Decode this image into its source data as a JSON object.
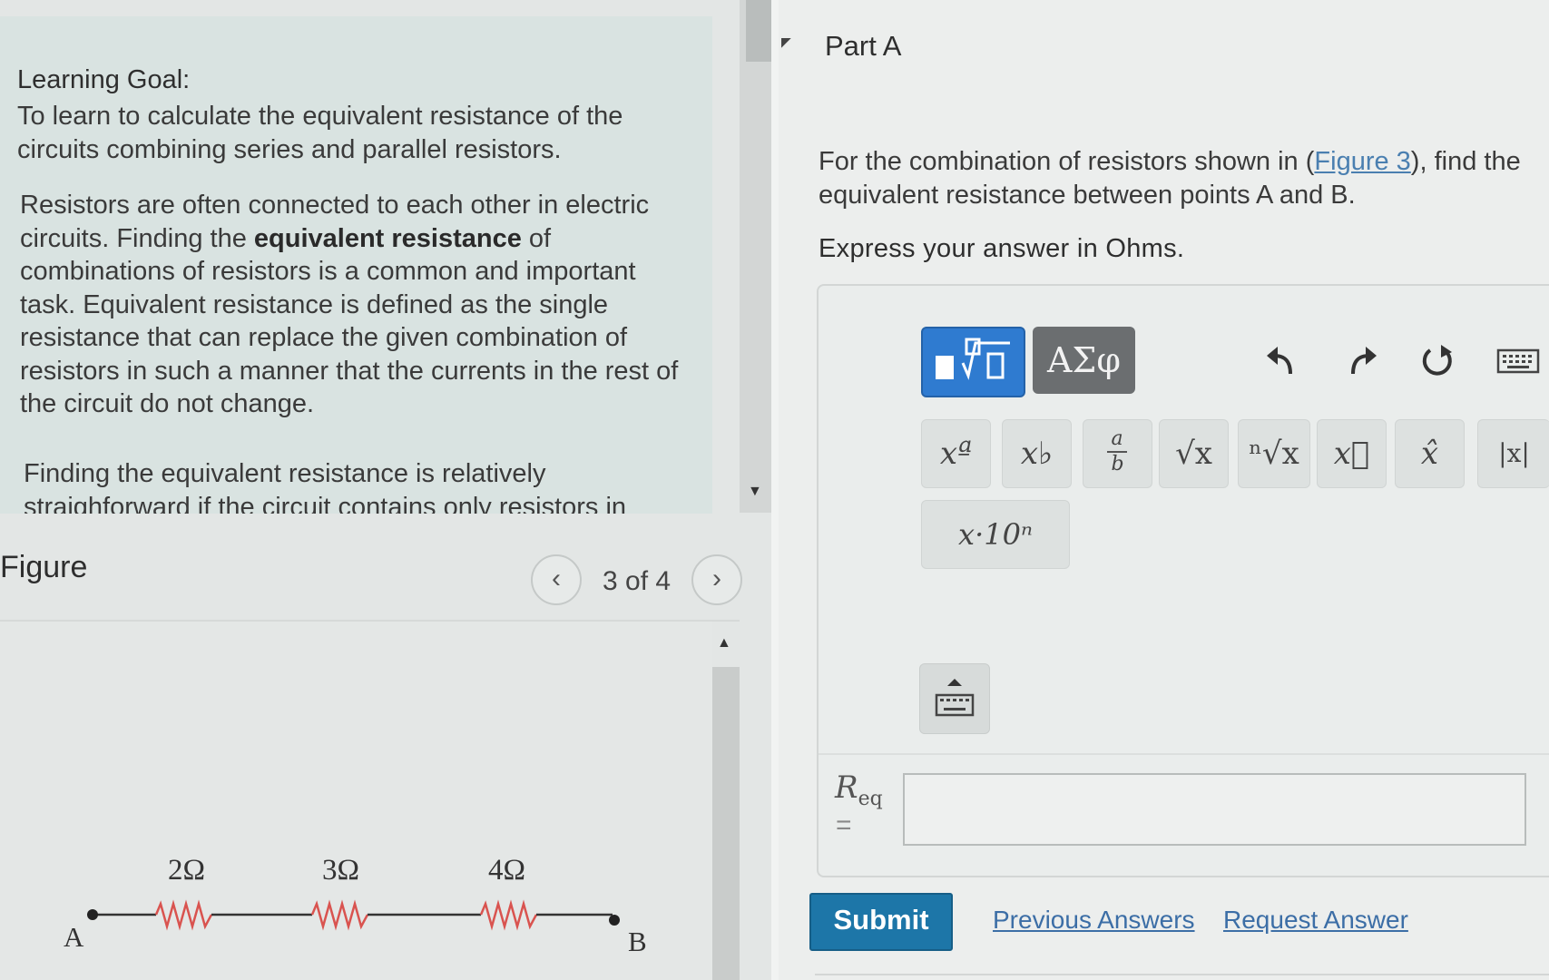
{
  "learning_goal": {
    "title": "Learning Goal:",
    "intro": "To learn to calculate the equivalent resistance of the circuits combining series and parallel resistors.",
    "p1_before": "Resistors are often connected to each other in electric circuits. Finding the ",
    "p1_bold": "equivalent resistance",
    "p1_after": " of combinations of resistors is a common and important task. Equivalent resistance is defined as the single resistance that can replace the given combination of resistors in such a manner that the currents in the rest of the circuit do not change.",
    "p2": "Finding the equivalent resistance is relatively straighforward if the circuit contains only resistors in"
  },
  "figure": {
    "label": "Figure",
    "prev_icon": "chevron-left-icon",
    "next_icon": "chevron-right-icon",
    "prev_glyph": "‹",
    "next_glyph": "›",
    "counter": "3 of 4",
    "circuit": {
      "point_a": "A",
      "point_b": "B",
      "resistors": [
        "2Ω",
        "3Ω",
        "4Ω"
      ],
      "wire_color": "#333333",
      "resistor_color": "#d9534f"
    }
  },
  "part": {
    "title": "Part A",
    "question_before": "For the combination of resistors shown in (",
    "question_link": "Figure 3",
    "question_after": "), find the equivalent resistance between points A and B.",
    "express": "Express your answer in Ohms."
  },
  "toolbar": {
    "templates_icon": "templates-icon",
    "greek_label": "ΑΣφ",
    "undo_icon": "undo-icon",
    "redo_icon": "redo-icon",
    "reset_icon": "reset-icon",
    "keyboard_icon": "keyboard-icon",
    "accent_color": "#2f7bd0"
  },
  "symbols": {
    "power": "xª",
    "subscript": "x♭",
    "fraction_top": "a",
    "fraction_bottom": "b",
    "sqrt": "√x",
    "nthroot": "ⁿ√x",
    "vector": "x⃗",
    "unit_vector": "x̂",
    "abs": "|x|",
    "sci": "x·10ⁿ"
  },
  "answer": {
    "label_main": "R",
    "label_sub": "eq",
    "equals": "=",
    "value": "",
    "placeholder": ""
  },
  "actions": {
    "submit": "Submit",
    "previous_answers": "Previous Answers",
    "request_answer": "Request Answer"
  }
}
